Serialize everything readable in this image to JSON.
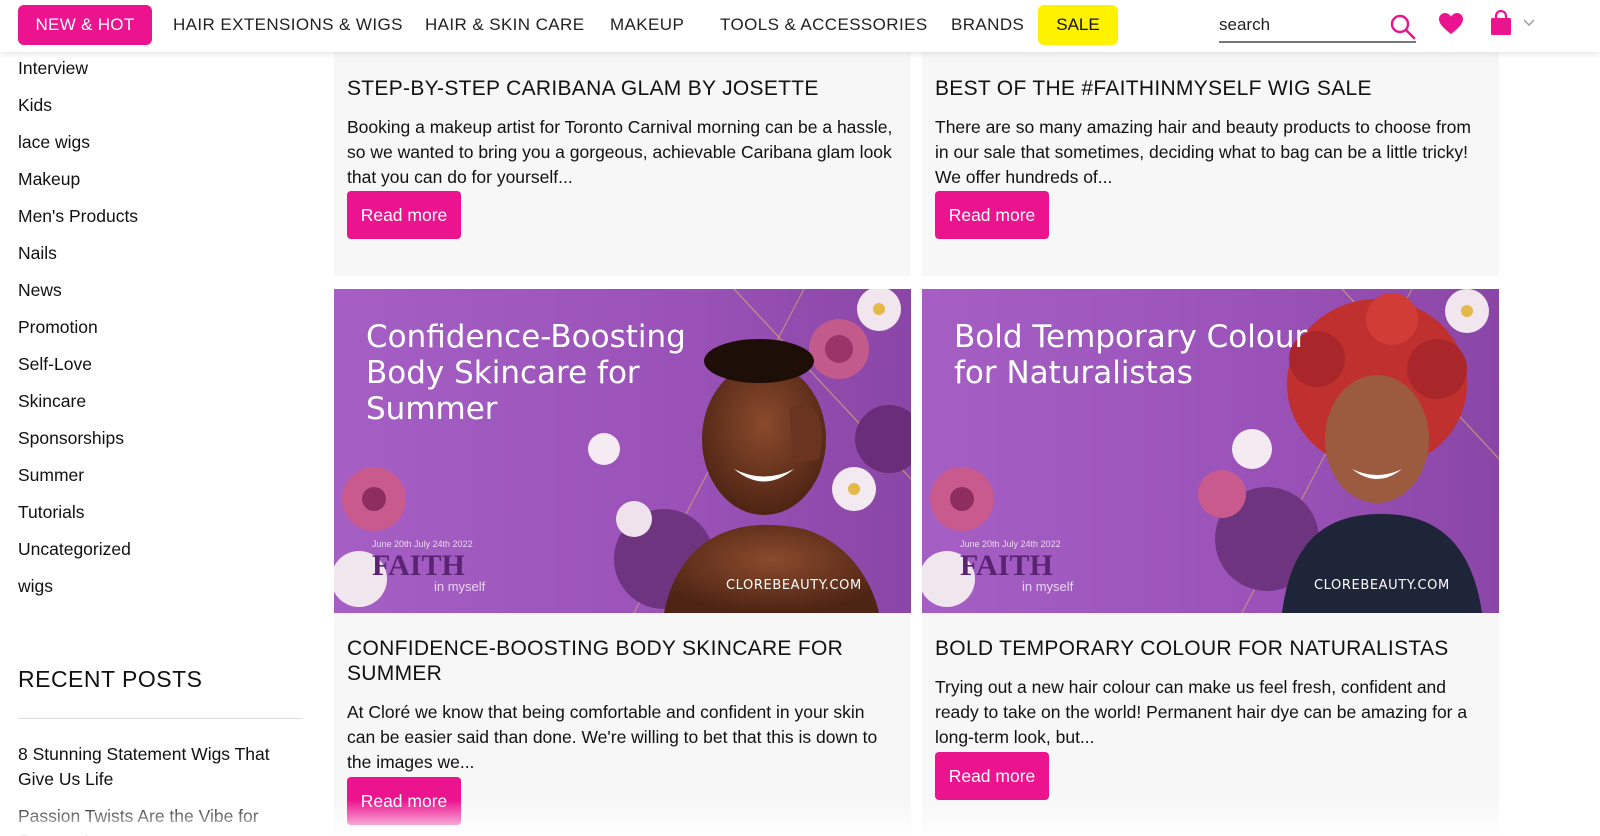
{
  "nav": {
    "new_hot": "NEW & HOT",
    "items": [
      "HAIR EXTENSIONS & WIGS",
      "HAIR & SKIN CARE",
      "MAKEUP",
      "TOOLS & ACCESSORIES",
      "BRANDS"
    ],
    "sale": "SALE",
    "search_placeholder": "search",
    "accent_color": "#ec138f",
    "sale_color": "#fff200"
  },
  "sidebar": {
    "categories": [
      "Interview",
      "Kids",
      "lace wigs",
      "Makeup",
      "Men's Products",
      "Nails",
      "News",
      "Promotion",
      "Self-Love",
      "Skincare",
      "Sponsorships",
      "Summer",
      "Tutorials",
      "Uncategorized",
      "wigs"
    ],
    "recent_heading": "RECENT POSTS",
    "recent_posts": [
      "8 Stunning Statement Wigs That Give Us Life",
      "Passion Twists Are the Vibe for Summer!"
    ]
  },
  "posts": [
    {
      "title": "STEP-BY-STEP CARIBANA GLAM BY JOSETTE",
      "excerpt": "Booking a makeup artist for Toronto Carnival morning can be a hassle, so we wanted to bring you a gorgeous, achievable Caribana glam look that you can do for yourself...",
      "read_more": "Read more"
    },
    {
      "title": "BEST OF THE #FAITHINMYSELF WIG SALE",
      "excerpt": "There are so many amazing hair and beauty products to choose from in our sale that sometimes, deciding what to bag can be a little tricky! We offer hundreds of...",
      "read_more": "Read more"
    },
    {
      "title": "CONFIDENCE-BOOSTING BODY SKINCARE FOR SUMMER",
      "excerpt": "At Cloré we know that being comfortable and confident in your skin can be easier said than done. We're willing to bet that this is down to the images we...",
      "read_more": "Read more",
      "banner": {
        "headline": [
          "Confidence-Boosting",
          "Body Skincare for",
          "Summer"
        ],
        "dates": "June 20th  July 24th 2022",
        "campaign": "FAITH",
        "campaign_sub": "in myself",
        "site": "CLOREBEAUTY.COM"
      }
    },
    {
      "title": "BOLD TEMPORARY COLOUR FOR NATURALISTAS",
      "excerpt": "Trying out a new hair colour can make us feel fresh, confident and ready to take on the world! Permanent hair dye can be amazing for a long-term look, but...",
      "read_more": "Read more",
      "banner": {
        "headline": [
          "Bold Temporary Colour",
          "for Naturalistas"
        ],
        "dates": "June 20th  July 24th 2022",
        "campaign": "FAITH",
        "campaign_sub": "in myself",
        "site": "CLOREBEAUTY.COM"
      }
    }
  ]
}
